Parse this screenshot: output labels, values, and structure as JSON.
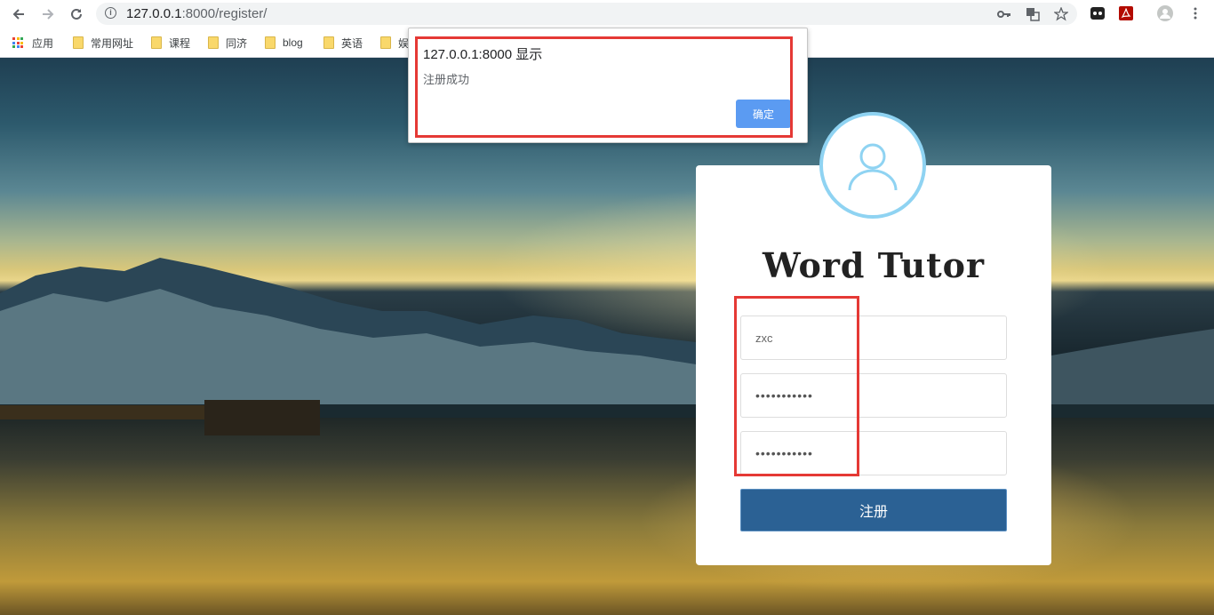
{
  "browser": {
    "url_host": "127.0.0.1",
    "url_path": ":8000/register/",
    "bookmarks": [
      {
        "label": "应用",
        "type": "apps"
      },
      {
        "label": "常用网址",
        "type": "folder"
      },
      {
        "label": "课程",
        "type": "folder"
      },
      {
        "label": "同济",
        "type": "folder"
      },
      {
        "label": "blog",
        "type": "folder"
      },
      {
        "label": "英语",
        "type": "folder"
      },
      {
        "label": "娱",
        "type": "folder"
      }
    ]
  },
  "dialog": {
    "title": "127.0.0.1:8000 显示",
    "message": "注册成功",
    "ok_label": "确定"
  },
  "form": {
    "brand": "Word Tutor",
    "username_value": "zxc",
    "password_value": "•••••••••••",
    "confirm_value": "•••••••••••",
    "submit_label": "注册"
  },
  "colors": {
    "accent": "#2b6194",
    "avatar_ring": "#8fd3f2",
    "dialog_button": "#5b9bf2",
    "highlight": "#e53935"
  }
}
